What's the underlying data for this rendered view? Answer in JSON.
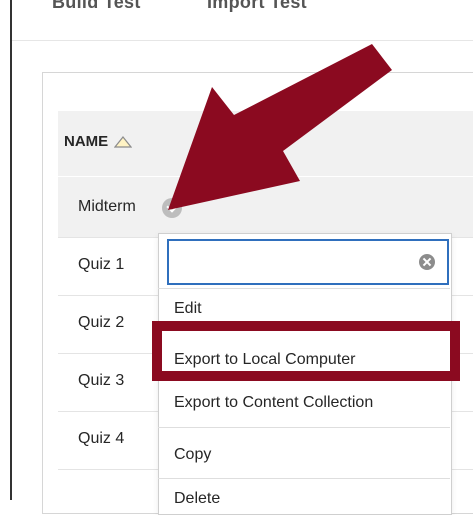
{
  "toolbar": {
    "build_test_label": "Build Test",
    "import_test_label": "Import Test"
  },
  "table": {
    "column_header": "NAME",
    "rows": [
      {
        "label": "Midterm"
      },
      {
        "label": "Quiz 1"
      },
      {
        "label": "Quiz 2"
      },
      {
        "label": "Quiz 3"
      },
      {
        "label": "Quiz 4"
      }
    ]
  },
  "context_menu": {
    "search_value": "",
    "items": [
      {
        "label": "Edit"
      },
      {
        "label": "Export to Local Computer"
      },
      {
        "label": "Export to Content Collection"
      },
      {
        "label": "Copy"
      },
      {
        "label": "Delete"
      }
    ]
  },
  "annotation": {
    "accent_color": "#8b0a20"
  }
}
